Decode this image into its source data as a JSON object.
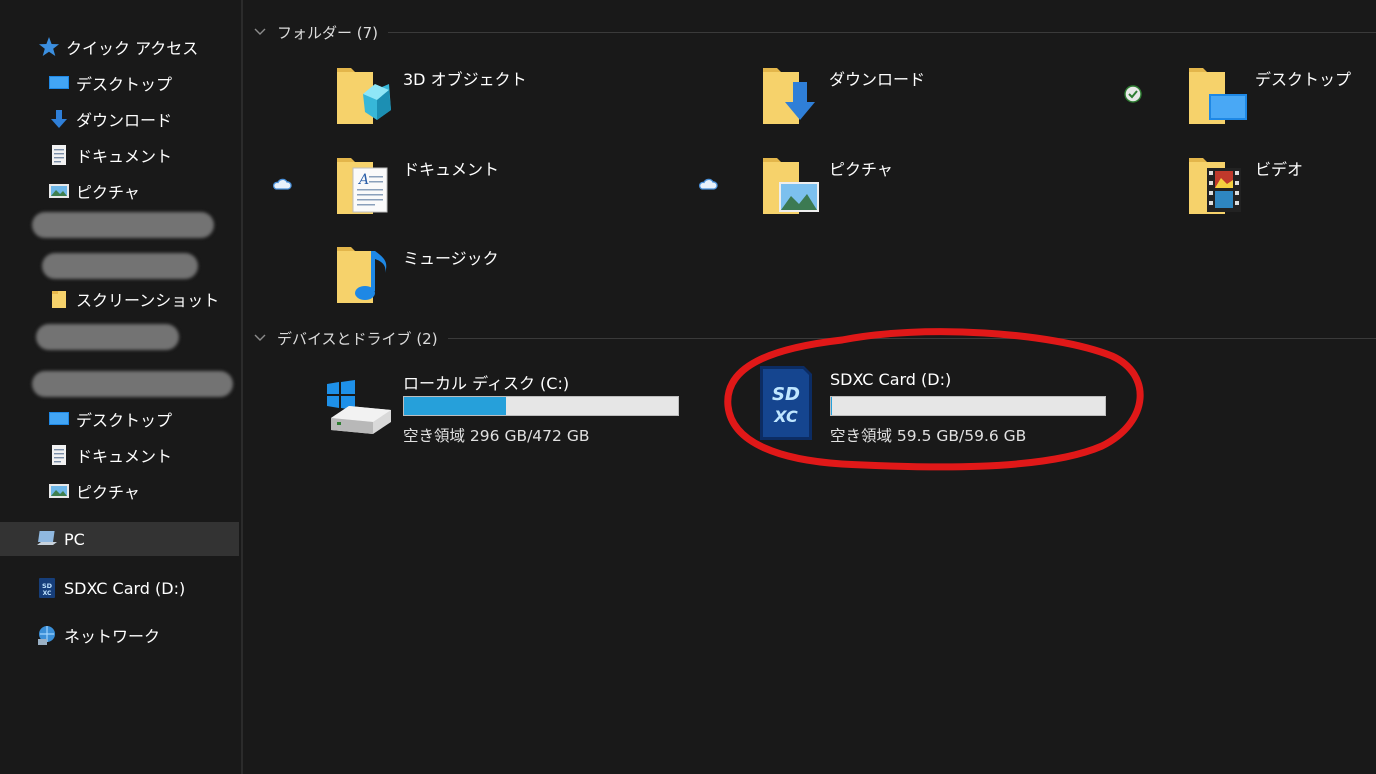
{
  "sidebar": {
    "quick_access": {
      "label": "クイック アクセス",
      "icon": "star-icon"
    },
    "pinned": [
      {
        "label": "デスクトップ",
        "icon": "desktop-icon"
      },
      {
        "label": "ダウンロード",
        "icon": "download-icon"
      },
      {
        "label": "ドキュメント",
        "icon": "document-icon"
      },
      {
        "label": "ピクチャ",
        "icon": "picture-icon"
      }
    ],
    "screenshots": {
      "label": "スクリーンショット",
      "icon": "folder-icon"
    },
    "lower": [
      {
        "label": "デスクトップ",
        "icon": "desktop-icon"
      },
      {
        "label": "ドキュメント",
        "icon": "document-icon"
      },
      {
        "label": "ピクチャ",
        "icon": "picture-icon"
      }
    ],
    "pc": {
      "label": "PC",
      "icon": "pc-icon"
    },
    "sdcard": {
      "label": "SDXC Card (D:)",
      "icon": "sdcard-icon"
    },
    "network": {
      "label": "ネットワーク",
      "icon": "network-icon"
    }
  },
  "folders_section": {
    "label": "フォルダー (7)"
  },
  "folders": [
    {
      "name": "3D オブジェクト",
      "overlay": "cube",
      "status": "none"
    },
    {
      "name": "ダウンロード",
      "overlay": "download-arrow",
      "status": "none"
    },
    {
      "name": "デスクトップ",
      "overlay": "desktop",
      "status": "synced-check"
    },
    {
      "name": "ドキュメント",
      "overlay": "document",
      "status": "cloud"
    },
    {
      "name": "ピクチャ",
      "overlay": "picture",
      "status": "cloud"
    },
    {
      "name": "ビデオ",
      "overlay": "film",
      "status": "none"
    },
    {
      "name": "ミュージック",
      "overlay": "music-note",
      "status": "none"
    }
  ],
  "drives_section": {
    "label": "デバイスとドライブ (2)"
  },
  "drives": [
    {
      "name": "ローカル ディスク (C:)",
      "free_text": "空き領域 296 GB/472 GB",
      "used_fraction": 0.373
    },
    {
      "name": "SDXC Card (D:)",
      "free_text": "空き領域 59.5 GB/59.6 GB",
      "used_fraction": 0.002
    }
  ],
  "colors": {
    "background": "#191919",
    "usage_bar": "#26a0da",
    "annotation": "#e01818",
    "selection": "#333333"
  }
}
